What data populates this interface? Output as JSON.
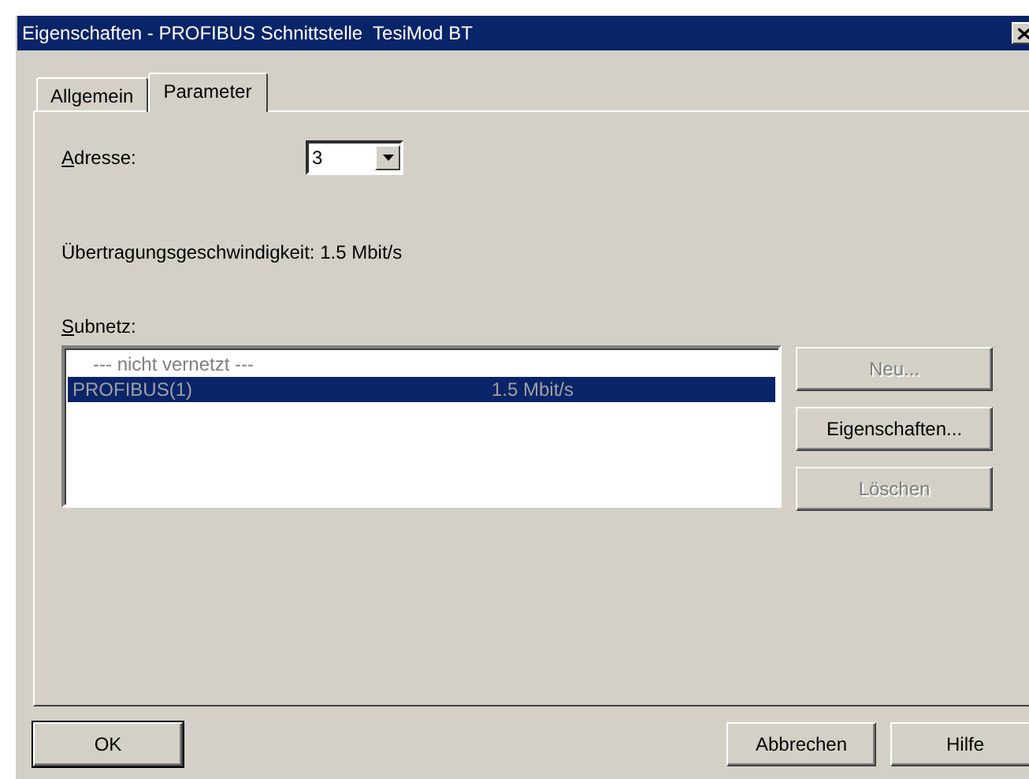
{
  "window": {
    "title": "Eigenschaften - PROFIBUS Schnittstelle  TesiMod BT"
  },
  "tabs": [
    {
      "label": "Allgemein",
      "selected": false
    },
    {
      "label": "Parameter",
      "selected": true
    }
  ],
  "address": {
    "label": "Adresse:",
    "value": "3"
  },
  "transmission_rate": "Übertragungsgeschwindigkeit: 1.5 Mbit/s",
  "subnet": {
    "label": "Subnetz:",
    "rows": [
      {
        "kind": "placeholder",
        "name": "--- nicht vernetzt ---",
        "selected": false
      },
      {
        "kind": "network",
        "name": "PROFIBUS(1)",
        "rate": "1.5 Mbit/s",
        "selected": true
      }
    ],
    "buttons": [
      {
        "label": "Neu...",
        "disabled": true
      },
      {
        "label": "Eigenschaften...",
        "disabled": false
      },
      {
        "label": "Löschen",
        "disabled": true
      }
    ]
  },
  "footer_buttons": [
    {
      "label": "OK",
      "default": true
    },
    {
      "label": "Abbrechen",
      "default": false
    },
    {
      "label": "Hilfe",
      "default": false
    }
  ]
}
